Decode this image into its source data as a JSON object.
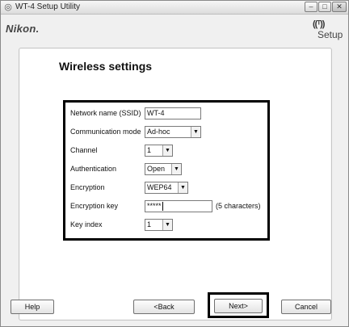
{
  "window": {
    "title": "WT-4 Setup Utility",
    "controls": {
      "minimize": "–",
      "maximize": "□",
      "close": "✕"
    }
  },
  "header": {
    "brand": "Nikon.",
    "setup_logo_text": "Setup",
    "setup_logo_waves": "((ᵀ))"
  },
  "page": {
    "title": "Wireless settings"
  },
  "form": {
    "ssid": {
      "label": "Network name (SSID)",
      "value": "WT-4"
    },
    "communication_mode": {
      "label": "Communication mode",
      "value": "Ad-hoc"
    },
    "channel": {
      "label": "Channel",
      "value": "1"
    },
    "authentication": {
      "label": "Authentication",
      "value": "Open"
    },
    "encryption": {
      "label": "Encryption",
      "value": "WEP64"
    },
    "encryption_key": {
      "label": "Encryption key",
      "value": "*****",
      "hint": "(5 characters)"
    },
    "key_index": {
      "label": "Key index",
      "value": "1"
    },
    "dropdown_arrow": "▼"
  },
  "buttons": {
    "help": "Help",
    "back": "<Back",
    "next": "Next>",
    "cancel": "Cancel"
  }
}
